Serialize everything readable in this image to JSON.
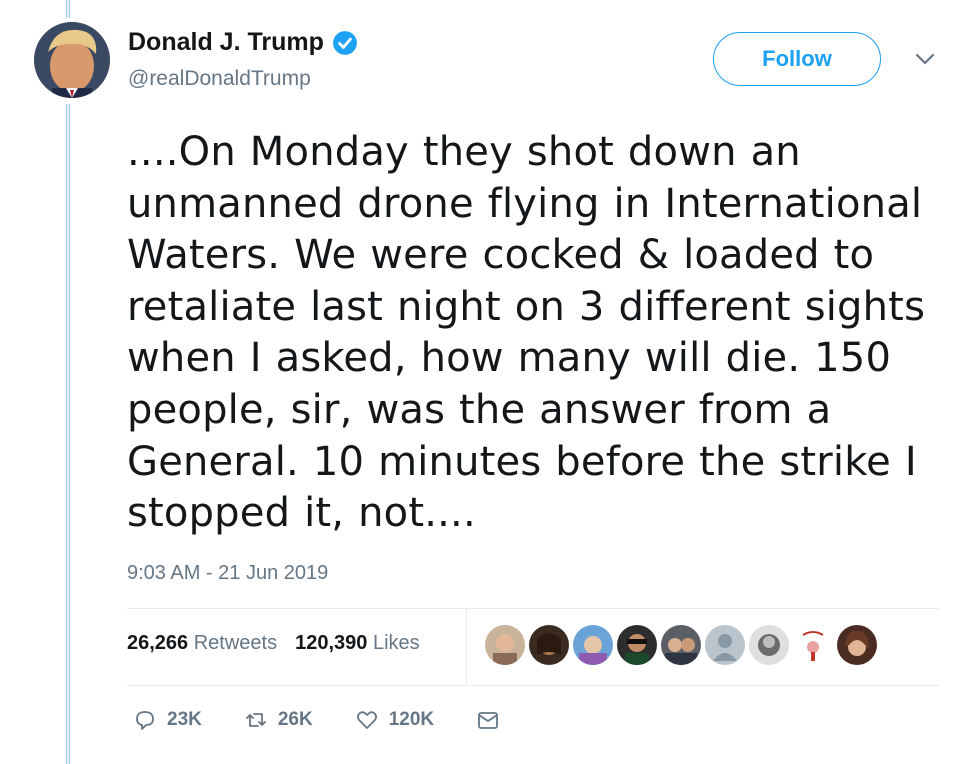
{
  "author": {
    "name": "Donald J. Trump",
    "handle": "@realDonaldTrump",
    "verified": true
  },
  "follow_label": "Follow",
  "tweet": {
    "lines": [
      "....On Monday they shot down an",
      "unmanned drone flying in International",
      "Waters. We were cocked & loaded to",
      "retaliate last night on 3 different sights",
      "when I asked, how many will die. 150",
      "people, sir, was the answer from a",
      "General. 10 minutes before the strike I",
      "stopped it, not...."
    ],
    "timestamp": "9:03 AM - 21 Jun 2019"
  },
  "stats": {
    "retweets_count": "26,266",
    "retweets_label": "Retweets",
    "likes_count": "120,390",
    "likes_label": "Likes"
  },
  "actions": {
    "replies": "23K",
    "retweets": "26K",
    "likes": "120K"
  },
  "colors": {
    "accent": "#1da1f2",
    "secondary_text": "#657786",
    "primary_text": "#14171a"
  }
}
